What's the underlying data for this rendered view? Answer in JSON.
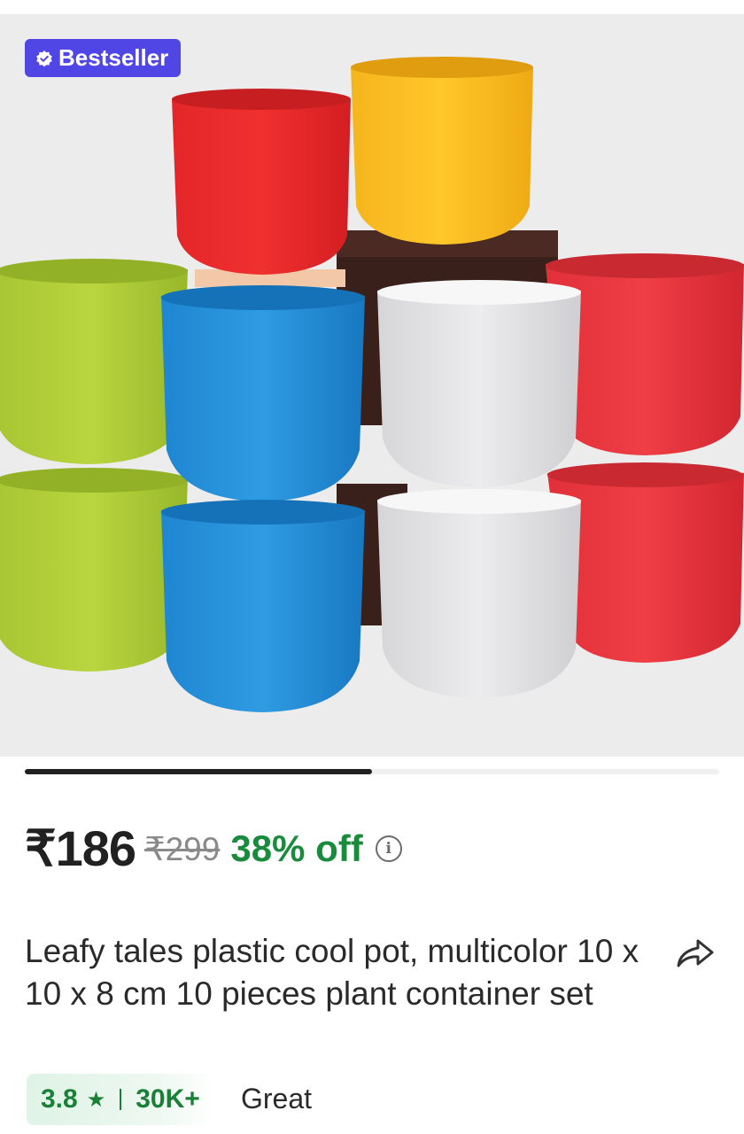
{
  "badge": {
    "label": "Bestseller",
    "icon": "verified-check-icon",
    "color": "#4f46e5"
  },
  "gallery": {
    "progress": 0.5,
    "image_alt": "Multicolor plastic plant pots"
  },
  "price": {
    "current": "₹186",
    "original": "₹299",
    "discount": "38% off",
    "info_icon": "info-icon",
    "discount_color": "#1a8a3c"
  },
  "product": {
    "title": "Leafy tales plastic cool pot, multicolor 10 x 10 x 8 cm 10 pieces plant container set",
    "share_icon": "share-icon"
  },
  "rating": {
    "value": "3.8",
    "star": "★",
    "count": "30K+",
    "label": "Great",
    "color": "#1a7f37"
  }
}
